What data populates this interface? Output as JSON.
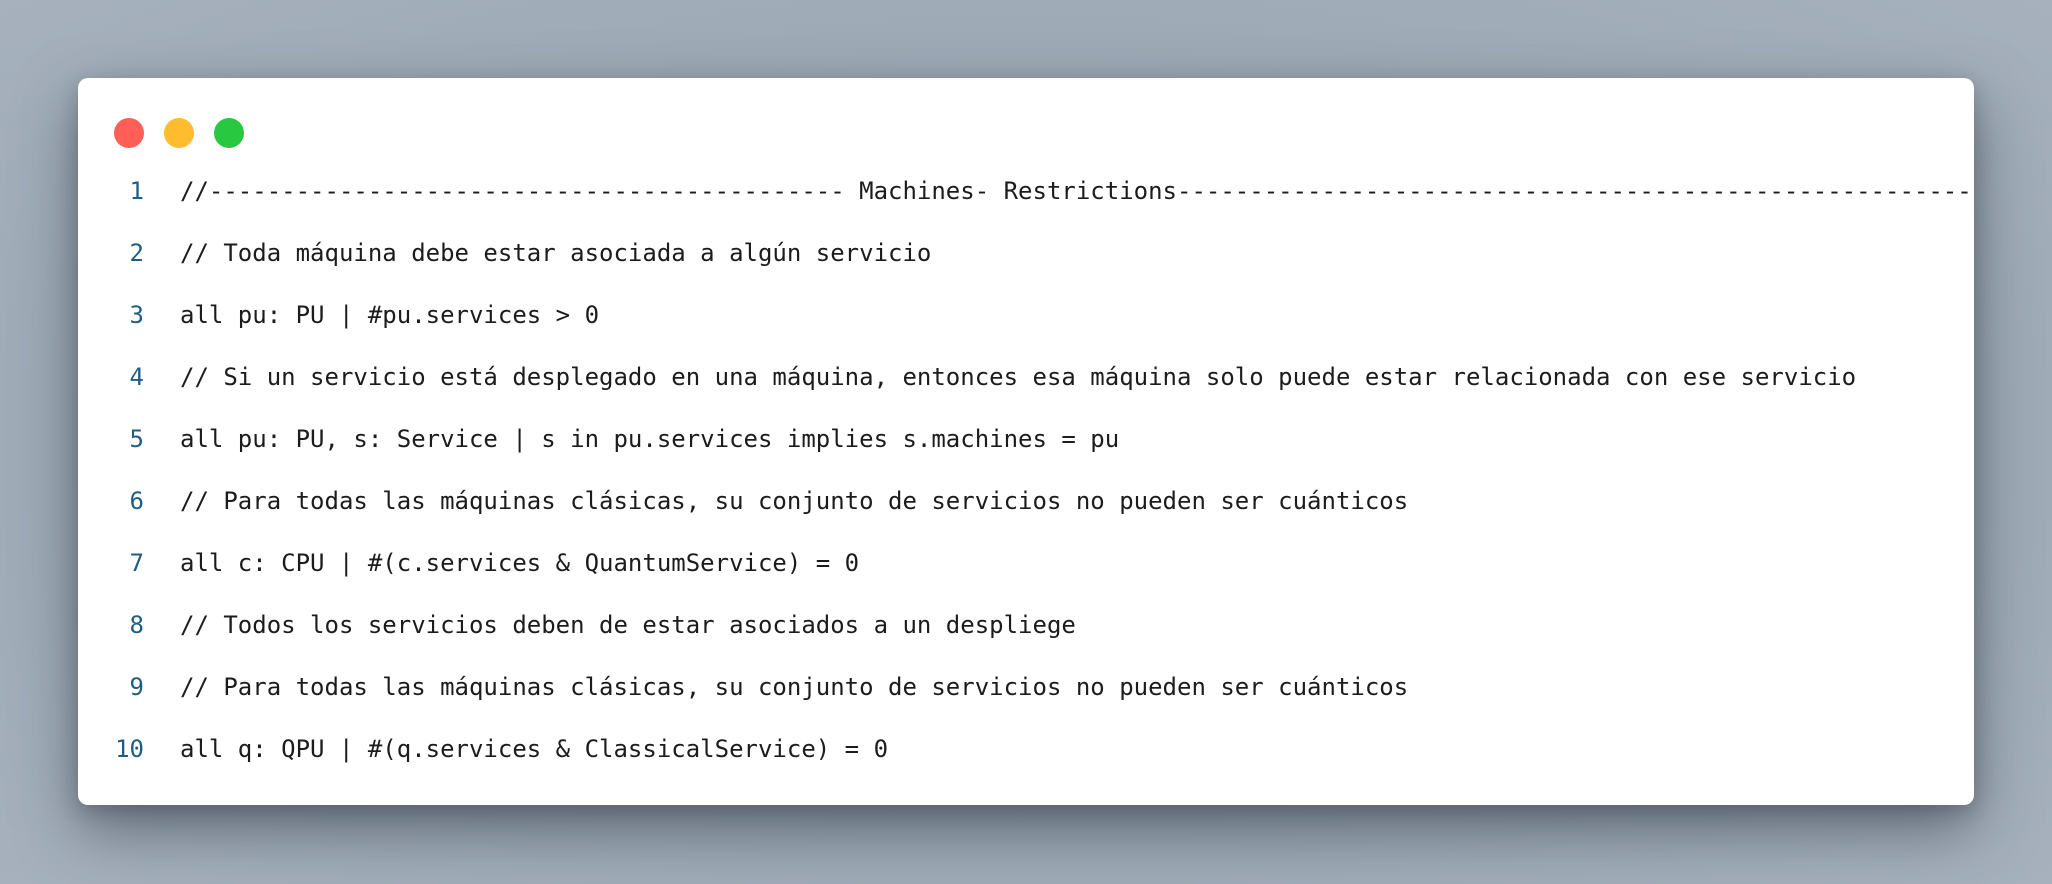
{
  "window": {
    "controls": [
      {
        "name": "close",
        "color": "#ff5f57"
      },
      {
        "name": "minimize",
        "color": "#febc2e"
      },
      {
        "name": "maximize",
        "color": "#28c840"
      }
    ]
  },
  "code": {
    "lines": [
      {
        "number": "1",
        "text": "//-------------------------------------------- Machines- Restrictions-------------------------------------------------------"
      },
      {
        "number": "2",
        "text": "// Toda máquina debe estar asociada a algún servicio"
      },
      {
        "number": "3",
        "text": "all pu: PU | #pu.services > 0"
      },
      {
        "number": "4",
        "text": "// Si un servicio está desplegado en una máquina, entonces esa máquina solo puede estar relacionada con ese servicio"
      },
      {
        "number": "5",
        "text": "all pu: PU, s: Service | s in pu.services implies s.machines = pu"
      },
      {
        "number": "6",
        "text": "// Para todas las máquinas clásicas, su conjunto de servicios no pueden ser cuánticos"
      },
      {
        "number": "7",
        "text": "all c: CPU | #(c.services & QuantumService) = 0"
      },
      {
        "number": "8",
        "text": "// Todos los servicios deben de estar asociados a un despliege"
      },
      {
        "number": "9",
        "text": "// Para todas las máquinas clásicas, su conjunto de servicios no pueden ser cuánticos"
      },
      {
        "number": "10",
        "text": "all q: QPU | #(q.services & ClassicalService) = 0"
      }
    ]
  }
}
